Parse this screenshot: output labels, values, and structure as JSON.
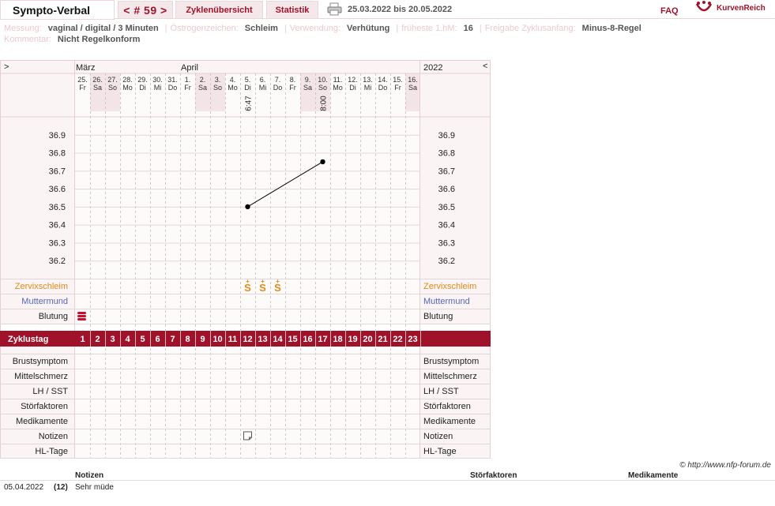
{
  "header": {
    "brand": "Sympto-Verbal",
    "cycle_nav": "< # 59 >",
    "tab_overview": "Zyklenübersicht",
    "tab_stats": "Statistik",
    "date_range": "25.03.2022 bis 20.05.2022",
    "faq": "FAQ",
    "logo_text": "KurvenReich"
  },
  "info": {
    "messung_label": "Messung:",
    "messung_value": "vaginal / digital / 3 Minuten",
    "oestrogen_label": "Östrogenzeichen:",
    "oestrogen_value": "Schleim",
    "verwendung_label": "Verwendung:",
    "verwendung_value": "Verhütung",
    "hm_label": "früheste 1.hM:",
    "hm_value": "16",
    "freigabe_label": "Freigabe Zyklusanfang:",
    "freigabe_value": "Minus-8-Regel",
    "kommentar_label": "Kommentar:",
    "kommentar_value": "Nicht Regelkonform"
  },
  "chart_data": {
    "type": "line",
    "prev_arrow": ">",
    "next_arrow": "<",
    "year": "2022",
    "months": [
      {
        "label": "März",
        "start_index": 0
      },
      {
        "label": "April",
        "start_index": 7
      }
    ],
    "days": [
      {
        "d": "25.",
        "w": "Fr",
        "weekend": false
      },
      {
        "d": "26.",
        "w": "Sa",
        "weekend": true
      },
      {
        "d": "27.",
        "w": "So",
        "weekend": true
      },
      {
        "d": "28.",
        "w": "Mo",
        "weekend": false
      },
      {
        "d": "29.",
        "w": "Di",
        "weekend": false
      },
      {
        "d": "30.",
        "w": "Mi",
        "weekend": false
      },
      {
        "d": "31.",
        "w": "Do",
        "weekend": false
      },
      {
        "d": "1.",
        "w": "Fr",
        "weekend": false
      },
      {
        "d": "2.",
        "w": "Sa",
        "weekend": true
      },
      {
        "d": "3.",
        "w": "So",
        "weekend": true
      },
      {
        "d": "4.",
        "w": "Mo",
        "weekend": false
      },
      {
        "d": "5.",
        "w": "Di",
        "weekend": false
      },
      {
        "d": "6.",
        "w": "Mi",
        "weekend": false
      },
      {
        "d": "7.",
        "w": "Do",
        "weekend": false
      },
      {
        "d": "8.",
        "w": "Fr",
        "weekend": false
      },
      {
        "d": "9.",
        "w": "Sa",
        "weekend": true
      },
      {
        "d": "10.",
        "w": "So",
        "weekend": true
      },
      {
        "d": "11.",
        "w": "Mo",
        "weekend": false
      },
      {
        "d": "12.",
        "w": "Di",
        "weekend": false
      },
      {
        "d": "13.",
        "w": "Mi",
        "weekend": false
      },
      {
        "d": "14.",
        "w": "Do",
        "weekend": false
      },
      {
        "d": "15.",
        "w": "Fr",
        "weekend": false
      },
      {
        "d": "16.",
        "w": "Sa",
        "weekend": true
      }
    ],
    "times": [
      {
        "index": 11,
        "value": "6:47"
      },
      {
        "index": 16,
        "value": "8:00"
      }
    ],
    "y_ticks": [
      "36.9",
      "36.8",
      "36.7",
      "36.6",
      "36.5",
      "36.4",
      "36.3",
      "36.2"
    ],
    "ylim": [
      36.1,
      37.0
    ],
    "temperature": [
      {
        "index": 11,
        "value": 36.5
      },
      {
        "index": 16,
        "value": 36.75
      }
    ],
    "mucus": [
      {
        "index": 11,
        "symbol": "S+"
      },
      {
        "index": 12,
        "symbol": "S+"
      },
      {
        "index": 13,
        "symbol": "S+"
      }
    ],
    "bleeding": [
      {
        "index": 0,
        "level": "heavy"
      }
    ],
    "notes_marker": [
      {
        "index": 11
      }
    ],
    "labels": {
      "zervix": "Zervixschleim",
      "muttermund": "Muttermund",
      "blutung": "Blutung",
      "zyklustag": "Zyklustag",
      "lower": [
        "Brustsymptom",
        "Mittelschmerz",
        "LH / SST",
        "Störfaktoren",
        "Medikamente",
        "Notizen",
        "HL-Tage"
      ]
    },
    "cycle_days": [
      "1",
      "2",
      "3",
      "4",
      "5",
      "6",
      "7",
      "8",
      "9",
      "10",
      "11",
      "12",
      "13",
      "14",
      "15",
      "16",
      "17",
      "18",
      "19",
      "20",
      "21",
      "22",
      "23"
    ]
  },
  "colors": {
    "accent": "#a0122a",
    "weekend": "#f3e4e7",
    "panel": "#fbf4f5",
    "mucus": "#e08a1c",
    "muttermund": "#5566bb",
    "zervix_label": "#e08a1c"
  },
  "footer": {
    "credit": "© http://www.nfp-forum.de",
    "notes_col_notes": "Notizen",
    "notes_col_stoer": "Störfaktoren",
    "notes_col_medi": "Medikamente",
    "note_date": "05.04.2022",
    "note_day": "(12)",
    "note_text": "Sehr müde"
  }
}
